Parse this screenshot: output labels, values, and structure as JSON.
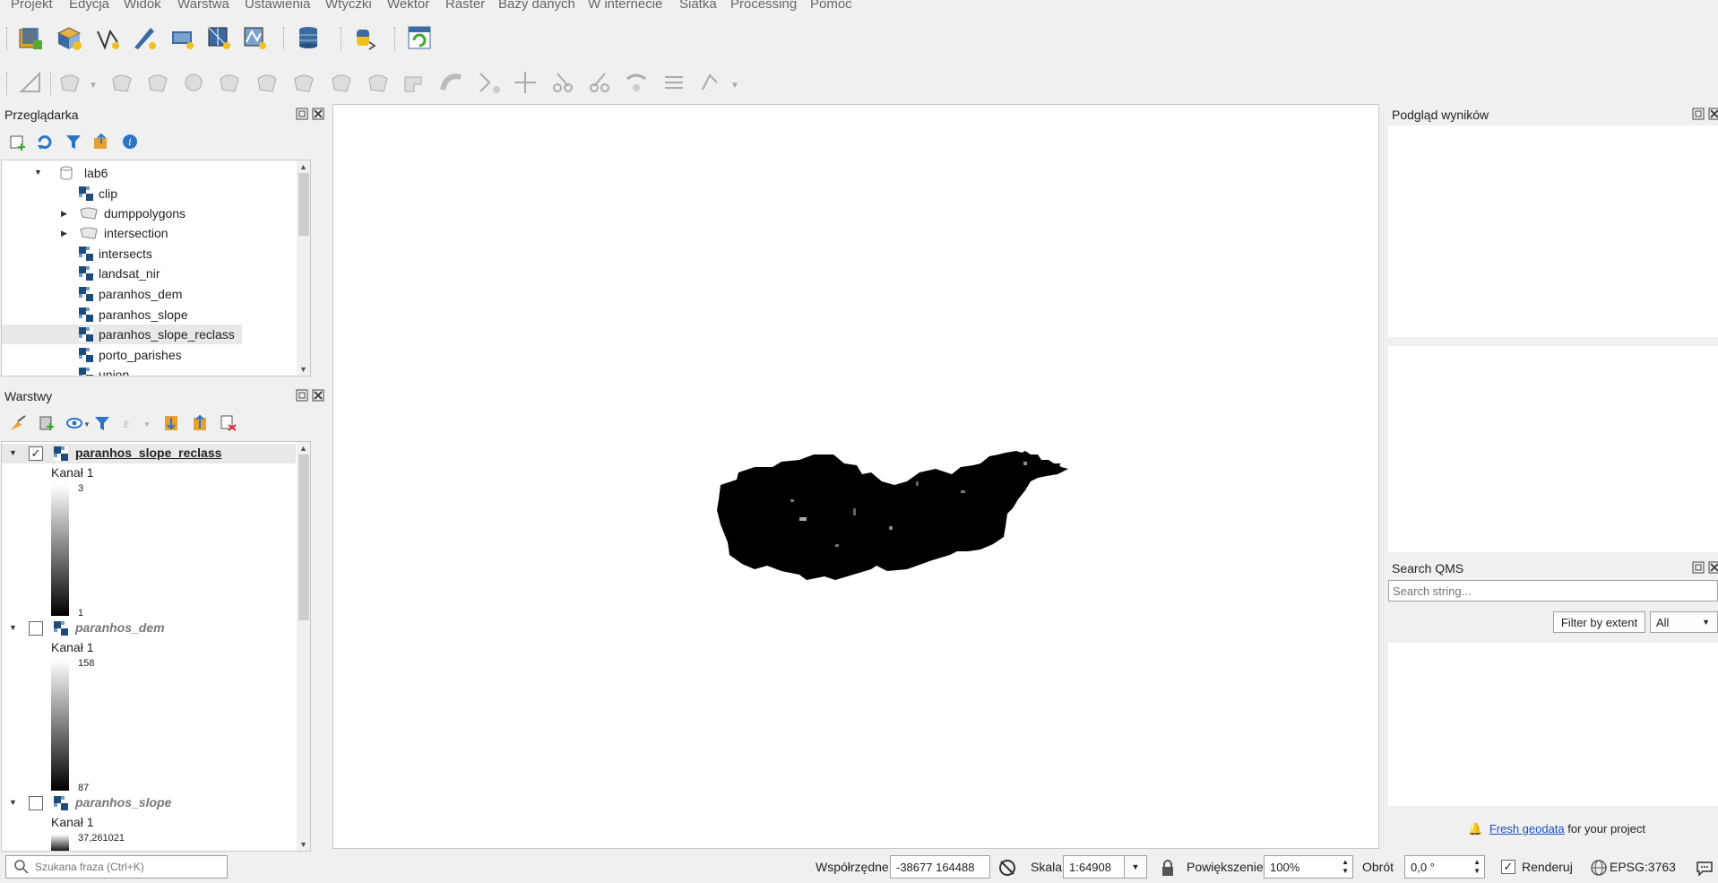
{
  "menu": [
    "Projekt",
    "Edycja",
    "Widok",
    "Warstwa",
    "Ustawienia",
    "Wtyczki",
    "Wektor",
    "Raster",
    "Bazy danych",
    "W internecie",
    "Siatka",
    "Processing",
    "Pomoc"
  ],
  "browser": {
    "title": "Przeglądarka",
    "items": [
      {
        "label": "lab6",
        "type": "db",
        "expanded": true
      },
      {
        "label": "clip",
        "type": "raster"
      },
      {
        "label": "dumppolygons",
        "type": "vector",
        "collapsed": true
      },
      {
        "label": "intersection",
        "type": "vector",
        "collapsed": true
      },
      {
        "label": "intersects",
        "type": "raster"
      },
      {
        "label": "landsat_nir",
        "type": "raster"
      },
      {
        "label": "paranhos_dem",
        "type": "raster"
      },
      {
        "label": "paranhos_slope",
        "type": "raster"
      },
      {
        "label": "paranhos_slope_reclass",
        "type": "raster",
        "selected": true
      },
      {
        "label": "porto_parishes",
        "type": "raster"
      },
      {
        "label": "union",
        "type": "raster"
      }
    ]
  },
  "layers": {
    "title": "Warstwy",
    "items": [
      {
        "name": "paranhos_slope_reclass",
        "checked": true,
        "band": "Kanał 1",
        "max": "3",
        "min": "1"
      },
      {
        "name": "paranhos_dem",
        "checked": false,
        "band": "Kanał 1",
        "max": "158",
        "min": "87"
      },
      {
        "name": "paranhos_slope",
        "checked": false,
        "band": "Kanał 1",
        "max": "37,261021"
      }
    ]
  },
  "results": {
    "title": "Podgląd wyników"
  },
  "qms": {
    "title": "Search QMS",
    "search_placeholder": "Search string...",
    "filter_label": "Filter by extent",
    "filter_value": "All",
    "footer_link": "Fresh geodata",
    "footer_text": " for your project"
  },
  "status": {
    "search_placeholder": "Szukana fraza (Ctrl+K)",
    "coords_label": "Współrzędne",
    "coords_value": "-38677  164488",
    "scale_label": "Skala",
    "scale_value": "1:64908",
    "zoom_label": "Powiększenie",
    "zoom_value": "100%",
    "rotation_label": "Obrót",
    "rotation_value": "0,0 °",
    "render_label": "Renderuj",
    "render_checked": true,
    "crs": "EPSG:3763"
  }
}
